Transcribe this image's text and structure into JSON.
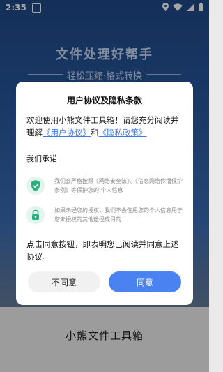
{
  "status_bar": {
    "time": "2:35"
  },
  "background": {
    "title": "文件处理好帮手",
    "subtitle": "轻松压缩·格式转换",
    "app_name": "小熊文件工具箱"
  },
  "dialog": {
    "title": "用户协议及隐私条款",
    "intro_text": "欢迎使用小熊文件工具箱！请您充分阅读并理解",
    "user_agreement_link": "《用户协议》",
    "and_text": "和",
    "privacy_link": "《隐私政策》",
    "promise_heading": "我们承诺",
    "promises": [
      {
        "icon": "shield-check-icon",
        "text": "我们会严格按照《网络安全法》、《信息网络传播保护条例》等保护您的 个人信息"
      },
      {
        "icon": "lock-icon",
        "text": "如果未经您的授权，我们不会使用您的个人信息用于您未授权的其他途径或目的"
      }
    ],
    "footer_text": "点击同意按钮，即表明您已阅读并同意上述协议。",
    "disagree_label": "不同意",
    "agree_label": "同意"
  },
  "colors": {
    "accent": "#4b82f1",
    "link": "#3c7ae8",
    "icon_green": "#2bb07f"
  }
}
